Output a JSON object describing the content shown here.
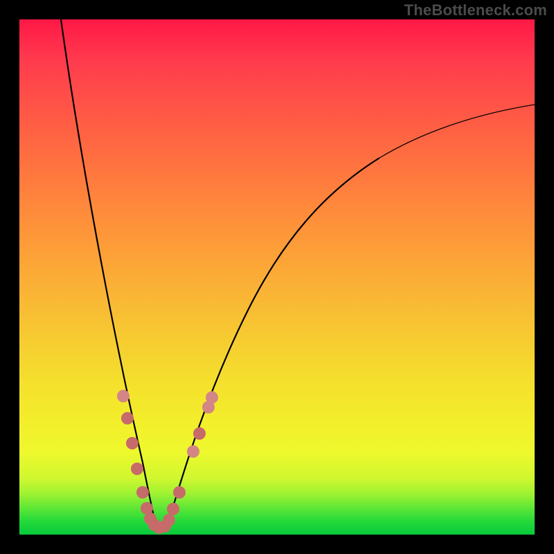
{
  "watermark_text": "TheBottleneck.com",
  "colors": {
    "border": "#000000",
    "curve": "#000000",
    "marker": "#c76a6a"
  },
  "chart_data": {
    "type": "line",
    "title": "",
    "xlabel": "",
    "ylabel": "",
    "xlim": [
      0,
      100
    ],
    "ylim": [
      0,
      100
    ],
    "note": "Axes unlabeled in source image. Values are estimated proportions of the plot area (0–100 each axis). y decreases downward in the image; here y=0 is bottom, y=100 is top.",
    "series": [
      {
        "name": "left-descending-curve",
        "x": [
          8,
          10,
          12,
          14,
          16,
          18,
          20,
          22,
          24,
          25.5
        ],
        "y": [
          100,
          88,
          76,
          63,
          50,
          38,
          26,
          15,
          6,
          1.5
        ]
      },
      {
        "name": "valley-floor",
        "x": [
          25.5,
          27,
          28.5
        ],
        "y": [
          1.5,
          1.2,
          1.5
        ]
      },
      {
        "name": "right-ascending-curve",
        "x": [
          28.5,
          31,
          34,
          38,
          43,
          50,
          58,
          67,
          77,
          88,
          100
        ],
        "y": [
          1.5,
          8,
          17,
          28,
          40,
          52,
          62,
          70,
          76,
          80,
          83
        ]
      }
    ],
    "markers": {
      "name": "highlighted-data-points",
      "x": [
        20.0,
        20.8,
        21.8,
        22.8,
        23.8,
        24.6,
        25.2,
        26.0,
        27.0,
        28.0,
        28.8,
        29.6,
        30.8,
        33.5,
        34.8,
        36.5,
        37.2
      ],
      "y": [
        27.0,
        22.5,
        17.8,
        12.5,
        8.0,
        5.0,
        3.0,
        1.8,
        1.3,
        1.6,
        2.8,
        4.8,
        8.0,
        16.0,
        19.5,
        24.5,
        26.5
      ]
    }
  }
}
